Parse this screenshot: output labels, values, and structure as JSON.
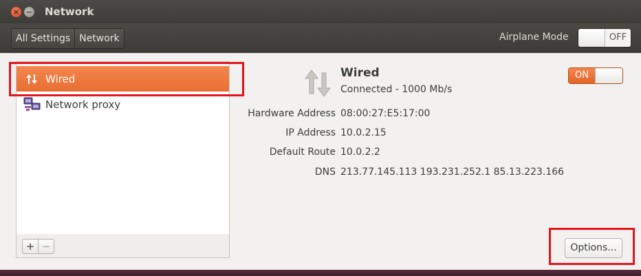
{
  "window": {
    "title": "Network"
  },
  "toolbar": {
    "breadcrumbs": [
      "All Settings",
      "Network"
    ],
    "airplane_mode_label": "Airplane Mode",
    "airplane_mode_state": "OFF"
  },
  "sidebar": {
    "items": [
      {
        "label": "Wired",
        "icon": "wired-arrows-icon",
        "selected": true
      },
      {
        "label": "Network proxy",
        "icon": "network-proxy-icon",
        "selected": false
      }
    ],
    "add_label": "+",
    "remove_label": "−"
  },
  "connection": {
    "name": "Wired",
    "status": "Connected - 1000 Mb/s",
    "toggle_state": "ON",
    "details": [
      {
        "key": "Hardware Address",
        "value": "08:00:27:E5:17:00"
      },
      {
        "key": "IP Address",
        "value": "10.0.2.15"
      },
      {
        "key": "Default Route",
        "value": "10.0.2.2"
      },
      {
        "key": "DNS",
        "value": "213.77.145.113 193.231.252.1 85.13.223.166"
      }
    ],
    "options_label": "Options..."
  },
  "colors": {
    "accent": "#e86f32",
    "highlight_box": "#e3141c",
    "titlebar": "#3d3c38"
  }
}
